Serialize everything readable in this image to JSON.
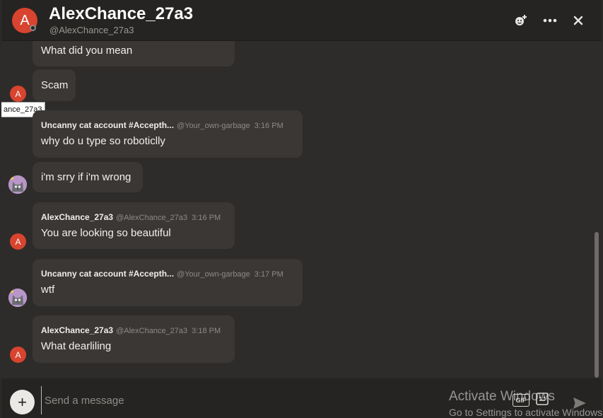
{
  "header": {
    "avatar_letter": "A",
    "title": "AlexChance_27a3",
    "subtitle": "@AlexChance_27a3",
    "icons": [
      "add-friend-icon",
      "more-options-icon",
      "close-icon"
    ]
  },
  "tooltip": "ance_27a3",
  "messages": [
    {
      "text": "What did you mean"
    },
    {
      "text": "Scam",
      "avatar_letter": "A"
    },
    {
      "username": "Uncanny cat account #Accepth...",
      "handle": "@Your_own-garbage",
      "time": "3:16 PM",
      "text": "why do u type so roboticlly"
    },
    {
      "text": "i'm srry if i'm wrong"
    },
    {
      "username": "AlexChance_27a3",
      "handle": "@AlexChance_27a3",
      "time": "3:16 PM",
      "text": "You are looking so beautiful",
      "avatar_letter": "A"
    },
    {
      "username": "Uncanny cat account #Accepth...",
      "handle": "@Your_own-garbage",
      "time": "3:17 PM",
      "text": "wtf"
    },
    {
      "username": "AlexChance_27a3",
      "handle": "@AlexChance_27a3",
      "time": "3:18 PM",
      "text": "What dearliling",
      "avatar_letter": "A"
    }
  ],
  "composer": {
    "placeholder": "Send a message",
    "plus_label": "+",
    "gif_label": "GIF"
  },
  "watermark": {
    "line1": "Activate Windows",
    "line2": "Go to Settings to activate Windows."
  },
  "colors": {
    "accent_avatar": "#d8442f",
    "background": "#2e2c2a",
    "bubble": "#3a3735"
  }
}
